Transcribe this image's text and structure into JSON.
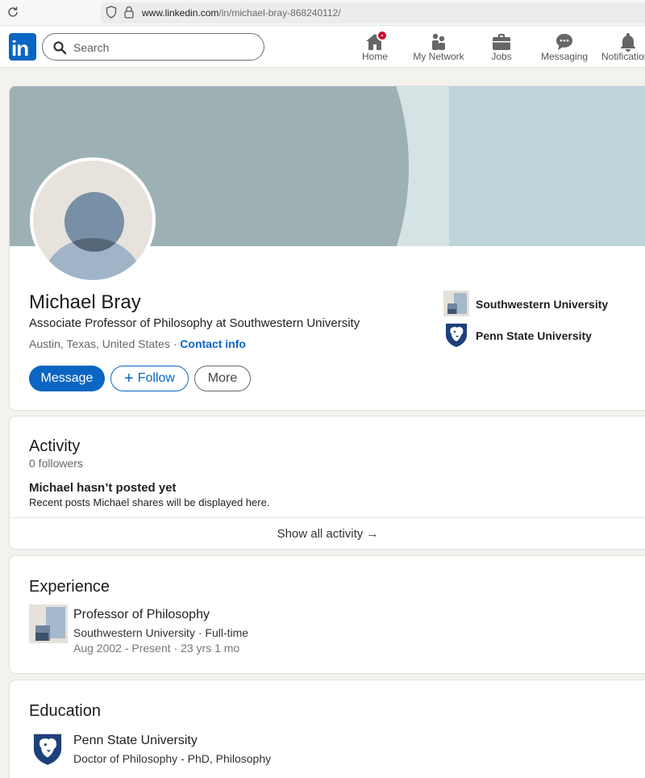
{
  "browser": {
    "url_host": "www.linkedin.com",
    "url_path": "/in/michael-bray-868240112/"
  },
  "nav": {
    "logo_text": "in",
    "search_placeholder": "Search",
    "items": [
      {
        "label": "Home",
        "icon": "home-icon",
        "badge": true
      },
      {
        "label": "My Network",
        "icon": "my-network-icon"
      },
      {
        "label": "Jobs",
        "icon": "jobs-briefcase-icon"
      },
      {
        "label": "Messaging",
        "icon": "messaging-icon"
      },
      {
        "label": "Notifications",
        "icon": "notifications-bell-icon"
      }
    ]
  },
  "profile": {
    "name": "Michael Bray",
    "headline": "Associate Professor of Philosophy at Southwestern University",
    "location": "Austin, Texas, United States",
    "separator": " · ",
    "contact_info": "Contact info",
    "buttons": {
      "message": "Message",
      "follow": "Follow",
      "more": "More"
    },
    "affiliations": [
      {
        "name": "Southwestern University",
        "logo": "southwestern-university-logo"
      },
      {
        "name": "Penn State University",
        "logo": "penn-state-logo"
      }
    ]
  },
  "activity": {
    "title": "Activity",
    "followers": "0 followers",
    "empty_title": "Michael hasn’t posted yet",
    "empty_sub": "Recent posts Michael shares will be displayed here.",
    "show_all": "Show all activity →"
  },
  "experience": {
    "title": "Experience",
    "items": [
      {
        "role": "Professor of Philosophy",
        "company": "Southwestern University · Full-time",
        "dates": "Aug 2002 - Present · 23 yrs 1 mo"
      }
    ]
  },
  "education": {
    "title": "Education",
    "items": [
      {
        "school": "Penn State University",
        "degree": "Doctor of Philosophy - PhD, Philosophy"
      }
    ]
  },
  "colors": {
    "brand": "#0a66c2",
    "badge": "#cb112d",
    "banner": "#bfd3da",
    "page_bg": "#f4f2ee"
  }
}
